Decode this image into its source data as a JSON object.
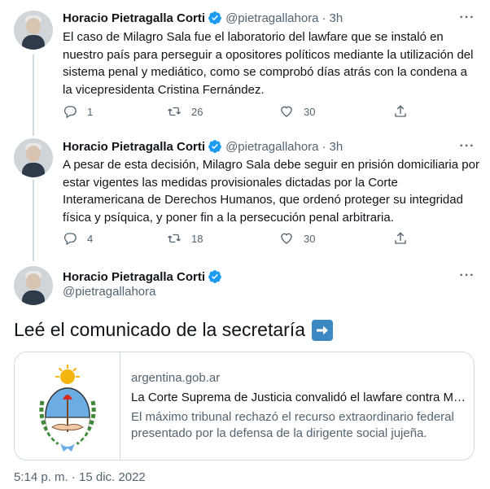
{
  "tweets": [
    {
      "author": "Horacio Pietragalla Corti",
      "handle": "@pietragallahora",
      "separator": "·",
      "time": "3h",
      "text": "El caso de Milagro Sala fue el laboratorio del lawfare que se instaló en nuestro país para perseguir a opositores políticos mediante la utilización del sistema penal y mediático, como se comprobó días atrás con la condena a la vicepresidenta Cristina Fernández.",
      "replies": "1",
      "retweets": "26",
      "likes": "30"
    },
    {
      "author": "Horacio Pietragalla Corti",
      "handle": "@pietragallahora",
      "separator": "·",
      "time": "3h",
      "text": "A pesar de esta decisión, Milagro Sala debe seguir en prisión domiciliaria por estar vigentes las medidas provisionales dictadas por la Corte Interamericana de Derechos Humanos, que ordenó proteger su integridad física y psíquica, y poner fin a la persecución penal arbitraria.",
      "replies": "4",
      "retweets": "18",
      "likes": "30"
    }
  ],
  "main_tweet": {
    "author": "Horacio Pietragalla Corti",
    "handle": "@pietragallahora",
    "text": "Leé el comunicado de la secretaría",
    "emoji": "right-arrow-emoji",
    "card": {
      "domain": "argentina.gob.ar",
      "title": "La Corte Suprema de Justicia convalidó el lawfare contra Milagro Sala",
      "description": "El máximo tribunal rechazó el recurso extraordinario federal presentado por la defensa de la dirigente social jujeña.",
      "image": "argentina-coat-of-arms"
    },
    "timestamp": "5:14 p. m. · 15 dic. 2022"
  },
  "icons": {
    "verified": "verified-badge-icon",
    "more": "more-icon",
    "reply": "reply-icon",
    "retweet": "retweet-icon",
    "like": "heart-icon",
    "share": "share-icon"
  },
  "colors": {
    "text": "#0f1419",
    "muted": "#536471",
    "verified": "#1d9bf0",
    "border": "#cfd9de",
    "emoji_bg": "#3b88c3"
  }
}
